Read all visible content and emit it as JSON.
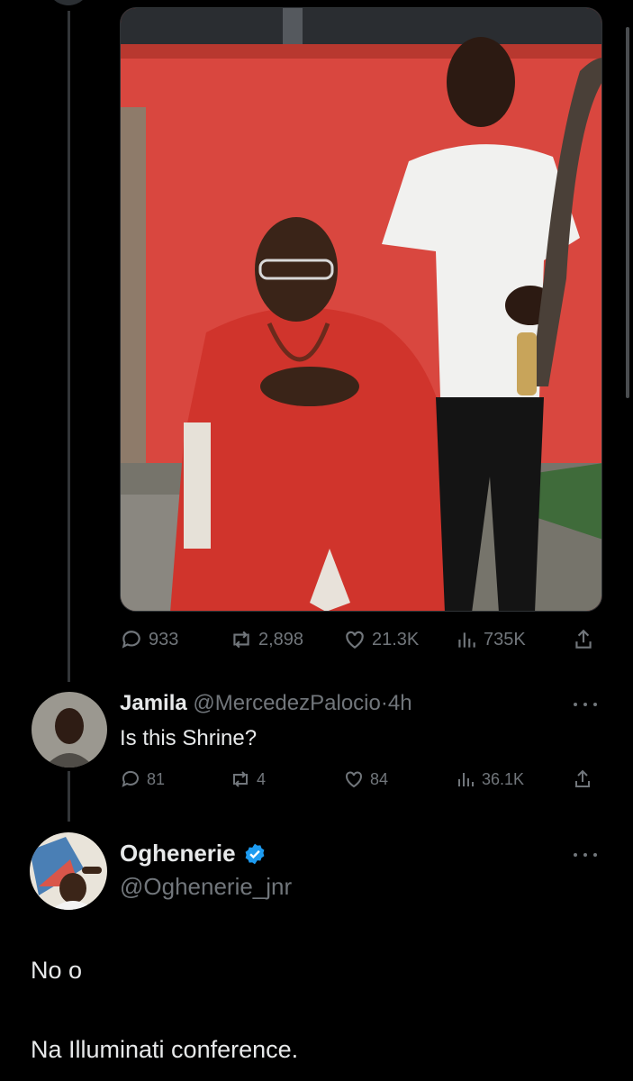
{
  "original_tweet": {
    "stats": {
      "replies": "933",
      "retweets": "2,898",
      "likes": "21.3K",
      "views": "735K"
    }
  },
  "reply": {
    "name": "Jamila",
    "handle": "@MercedezPalocio",
    "separator": "·",
    "time": "4h",
    "text": "Is this Shrine?",
    "stats": {
      "replies": "81",
      "retweets": "4",
      "likes": "84",
      "views": "36.1K"
    }
  },
  "focused_reply": {
    "name": "Oghenerie",
    "handle": "@Oghenerie_jnr",
    "verified": true,
    "lines": [
      "No o",
      "Na Illuminati conference."
    ]
  },
  "icons": [
    "reply-icon",
    "retweet-icon",
    "like-icon",
    "views-icon",
    "share-icon",
    "more-icon",
    "verified-badge-icon"
  ],
  "colors": {
    "background": "#000000",
    "text": "#e7e9ea",
    "muted": "#71767b",
    "verified": "#1d9bf0"
  }
}
